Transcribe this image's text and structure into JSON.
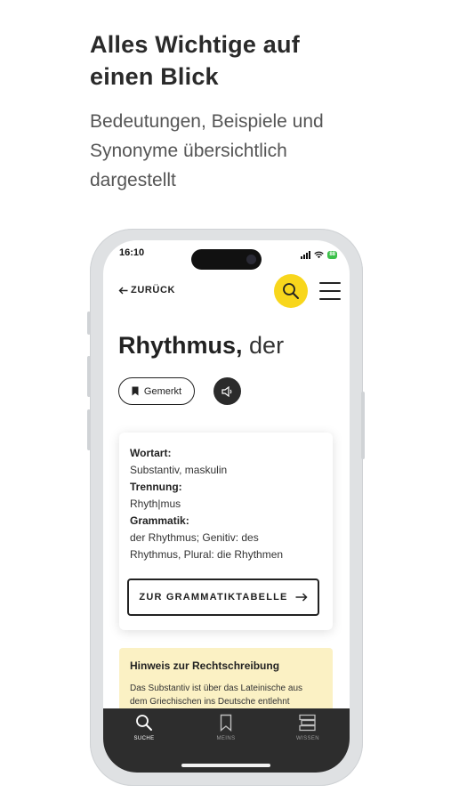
{
  "promo": {
    "headline_line1": "Alles Wichtige auf",
    "headline_line2": "einen Blick",
    "subline_line1": "Bedeutungen, Beispiele und",
    "subline_line2": "Synonyme übersichtlich",
    "subline_line3": "dargestellt"
  },
  "status_bar": {
    "time": "16:10",
    "battery": "88"
  },
  "header": {
    "back_label": "ZURÜCK",
    "search_icon": "search-icon",
    "menu_icon": "hamburger-menu-icon"
  },
  "entry": {
    "word": "Rhythmus,",
    "article": "der",
    "bookmark_label": "Gemerkt"
  },
  "info_card": {
    "wortart_label": "Wortart:",
    "wortart_value": "Substantiv, maskulin",
    "trennung_label": "Trennung:",
    "trennung_value": "Rhyth|mus",
    "grammatik_label": "Grammatik:",
    "grammatik_value_line1": "der Rhythmus; Genitiv: des",
    "grammatik_value_line2": "Rhythmus, Plural: die Rhythmen",
    "button_label": "ZUR GRAMMATIKTABELLE"
  },
  "hint": {
    "title": "Hinweis zur Rechtschreibung",
    "body_line1": "Das Substantiv ist über das Lateinische aus",
    "body_line2": "dem Griechischen ins Deutsche entlehnt"
  },
  "tab_bar": {
    "tabs": [
      {
        "label": "SUCHE",
        "icon": "search-icon",
        "active": true
      },
      {
        "label": "MEINS",
        "icon": "bookmark-icon",
        "active": false
      },
      {
        "label": "WISSEN",
        "icon": "books-icon",
        "active": false
      }
    ]
  },
  "colors": {
    "accent_yellow": "#f8d61c",
    "hint_background": "#fbf1c4",
    "tabbar_background": "#2d2d2d"
  }
}
